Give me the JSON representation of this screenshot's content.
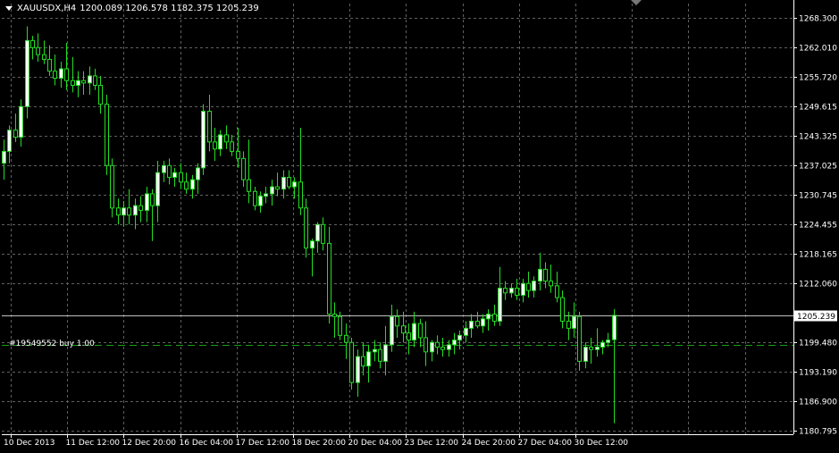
{
  "window": {
    "symbol_timeframe": "XAUUSDX,H4",
    "ohlc": "1200.089 1206.578 1182.375 1205.239"
  },
  "trade_line": {
    "label": "#19549552 buy 1.00",
    "price": 1199.0
  },
  "current_price": {
    "label": "1205.239",
    "value": 1205.239
  },
  "colors": {
    "background": "#000000",
    "grid": "#606060",
    "bull_fill": "#ffffff",
    "bear_fill": "#000000",
    "candle_outline": "#22dd22",
    "trade_line": "#1aa01a",
    "axis_text": "#ffffff"
  },
  "icons": {
    "menu": "triangle-down-icon",
    "scroll": "scroll-marker-icon"
  },
  "chart_data": {
    "type": "candlestick",
    "title": "XAUUSDX,H4",
    "grid": true,
    "y_ticks": [
      "1268.300",
      "1262.010",
      "1255.720",
      "1249.615",
      "1243.325",
      "1237.025",
      "1230.745",
      "1224.455",
      "1218.165",
      "1212.060",
      "1205.239",
      "1199.480",
      "1193.190",
      "1186.900",
      "1180.795"
    ],
    "y_range": [
      1180.795,
      1268.3
    ],
    "x_ticks": [
      "10 Dec 2013",
      "11 Dec 12:00",
      "12 Dec 20:00",
      "16 Dec 04:00",
      "17 Dec 12:00",
      "18 Dec 20:00",
      "20 Dec 04:00",
      "23 Dec 12:00",
      "24 Dec 20:00",
      "27 Dec 04:00",
      "30 Dec 12:00"
    ],
    "candles": [
      {
        "o": 1237.5,
        "h": 1242.5,
        "l": 1234.0,
        "c": 1240.0
      },
      {
        "o": 1240.0,
        "h": 1245.5,
        "l": 1237.5,
        "c": 1244.5
      },
      {
        "o": 1244.5,
        "h": 1248.0,
        "l": 1242.0,
        "c": 1243.0
      },
      {
        "o": 1243.0,
        "h": 1251.0,
        "l": 1241.0,
        "c": 1249.5
      },
      {
        "o": 1249.5,
        "h": 1266.5,
        "l": 1247.0,
        "c": 1263.5
      },
      {
        "o": 1263.5,
        "h": 1264.5,
        "l": 1259.5,
        "c": 1262.0
      },
      {
        "o": 1262.0,
        "h": 1265.0,
        "l": 1259.0,
        "c": 1260.5
      },
      {
        "o": 1260.5,
        "h": 1263.5,
        "l": 1258.5,
        "c": 1259.5
      },
      {
        "o": 1259.5,
        "h": 1262.5,
        "l": 1256.0,
        "c": 1257.0
      },
      {
        "o": 1257.0,
        "h": 1260.5,
        "l": 1254.0,
        "c": 1255.5
      },
      {
        "o": 1255.5,
        "h": 1259.0,
        "l": 1253.5,
        "c": 1257.5
      },
      {
        "o": 1257.5,
        "h": 1263.0,
        "l": 1253.0,
        "c": 1255.0
      },
      {
        "o": 1255.0,
        "h": 1260.0,
        "l": 1252.5,
        "c": 1254.0
      },
      {
        "o": 1254.0,
        "h": 1257.0,
        "l": 1251.5,
        "c": 1255.0
      },
      {
        "o": 1255.0,
        "h": 1257.0,
        "l": 1252.0,
        "c": 1254.5
      },
      {
        "o": 1254.5,
        "h": 1258.0,
        "l": 1252.0,
        "c": 1256.0
      },
      {
        "o": 1256.0,
        "h": 1257.5,
        "l": 1253.0,
        "c": 1254.0
      },
      {
        "o": 1254.0,
        "h": 1256.0,
        "l": 1248.0,
        "c": 1250.0
      },
      {
        "o": 1250.0,
        "h": 1252.0,
        "l": 1235.0,
        "c": 1237.0
      },
      {
        "o": 1237.0,
        "h": 1238.5,
        "l": 1226.0,
        "c": 1228.0
      },
      {
        "o": 1228.0,
        "h": 1230.0,
        "l": 1224.5,
        "c": 1226.5
      },
      {
        "o": 1226.5,
        "h": 1229.5,
        "l": 1224.0,
        "c": 1228.0
      },
      {
        "o": 1228.0,
        "h": 1232.0,
        "l": 1224.5,
        "c": 1226.5
      },
      {
        "o": 1226.5,
        "h": 1230.0,
        "l": 1223.5,
        "c": 1228.5
      },
      {
        "o": 1228.5,
        "h": 1230.5,
        "l": 1225.0,
        "c": 1227.5
      },
      {
        "o": 1227.5,
        "h": 1232.5,
        "l": 1225.0,
        "c": 1231.0
      },
      {
        "o": 1231.0,
        "h": 1232.0,
        "l": 1221.0,
        "c": 1228.5
      },
      {
        "o": 1228.5,
        "h": 1238.0,
        "l": 1225.0,
        "c": 1235.5
      },
      {
        "o": 1235.5,
        "h": 1238.0,
        "l": 1233.5,
        "c": 1237.0
      },
      {
        "o": 1237.0,
        "h": 1238.5,
        "l": 1233.0,
        "c": 1234.5
      },
      {
        "o": 1234.5,
        "h": 1236.5,
        "l": 1232.5,
        "c": 1235.5
      },
      {
        "o": 1235.5,
        "h": 1237.5,
        "l": 1232.0,
        "c": 1233.5
      },
      {
        "o": 1233.5,
        "h": 1235.5,
        "l": 1231.0,
        "c": 1232.0
      },
      {
        "o": 1232.0,
        "h": 1235.0,
        "l": 1230.0,
        "c": 1234.0
      },
      {
        "o": 1234.0,
        "h": 1237.5,
        "l": 1231.0,
        "c": 1236.5
      },
      {
        "o": 1236.5,
        "h": 1250.0,
        "l": 1235.0,
        "c": 1248.5
      },
      {
        "o": 1248.5,
        "h": 1252.0,
        "l": 1240.0,
        "c": 1242.0
      },
      {
        "o": 1242.0,
        "h": 1245.0,
        "l": 1238.0,
        "c": 1240.5
      },
      {
        "o": 1240.5,
        "h": 1244.5,
        "l": 1239.0,
        "c": 1243.5
      },
      {
        "o": 1243.5,
        "h": 1245.5,
        "l": 1240.5,
        "c": 1242.0
      },
      {
        "o": 1242.0,
        "h": 1243.5,
        "l": 1239.0,
        "c": 1240.0
      },
      {
        "o": 1240.0,
        "h": 1245.0,
        "l": 1236.5,
        "c": 1238.5
      },
      {
        "o": 1238.5,
        "h": 1240.0,
        "l": 1232.5,
        "c": 1234.0
      },
      {
        "o": 1234.0,
        "h": 1242.5,
        "l": 1229.0,
        "c": 1231.5
      },
      {
        "o": 1231.5,
        "h": 1232.5,
        "l": 1227.5,
        "c": 1228.5
      },
      {
        "o": 1228.5,
        "h": 1231.5,
        "l": 1227.0,
        "c": 1230.5
      },
      {
        "o": 1230.5,
        "h": 1232.5,
        "l": 1229.0,
        "c": 1231.0
      },
      {
        "o": 1231.0,
        "h": 1234.0,
        "l": 1228.5,
        "c": 1232.5
      },
      {
        "o": 1232.5,
        "h": 1235.5,
        "l": 1230.5,
        "c": 1232.0
      },
      {
        "o": 1232.0,
        "h": 1236.0,
        "l": 1230.0,
        "c": 1234.5
      },
      {
        "o": 1234.5,
        "h": 1236.0,
        "l": 1232.0,
        "c": 1232.5
      },
      {
        "o": 1232.5,
        "h": 1234.5,
        "l": 1230.0,
        "c": 1233.5
      },
      {
        "o": 1233.5,
        "h": 1245.0,
        "l": 1226.5,
        "c": 1228.0
      },
      {
        "o": 1228.0,
        "h": 1230.0,
        "l": 1217.5,
        "c": 1219.5
      },
      {
        "o": 1219.5,
        "h": 1221.5,
        "l": 1213.5,
        "c": 1221.0
      },
      {
        "o": 1221.0,
        "h": 1225.0,
        "l": 1218.5,
        "c": 1224.5
      },
      {
        "o": 1224.5,
        "h": 1226.0,
        "l": 1219.0,
        "c": 1220.5
      },
      {
        "o": 1220.5,
        "h": 1224.0,
        "l": 1203.5,
        "c": 1205.5
      },
      {
        "o": 1205.5,
        "h": 1208.0,
        "l": 1200.5,
        "c": 1205.0
      },
      {
        "o": 1205.0,
        "h": 1206.0,
        "l": 1200.0,
        "c": 1201.0
      },
      {
        "o": 1201.0,
        "h": 1203.5,
        "l": 1196.0,
        "c": 1199.5
      },
      {
        "o": 1199.5,
        "h": 1200.5,
        "l": 1189.5,
        "c": 1191.0
      },
      {
        "o": 1191.0,
        "h": 1198.0,
        "l": 1188.0,
        "c": 1196.5
      },
      {
        "o": 1196.5,
        "h": 1199.5,
        "l": 1192.5,
        "c": 1194.5
      },
      {
        "o": 1194.5,
        "h": 1199.0,
        "l": 1191.0,
        "c": 1197.5
      },
      {
        "o": 1197.5,
        "h": 1200.0,
        "l": 1195.5,
        "c": 1198.0
      },
      {
        "o": 1198.0,
        "h": 1199.5,
        "l": 1194.0,
        "c": 1195.5
      },
      {
        "o": 1195.5,
        "h": 1203.0,
        "l": 1192.5,
        "c": 1199.0
      },
      {
        "o": 1199.0,
        "h": 1207.5,
        "l": 1197.5,
        "c": 1205.0
      },
      {
        "o": 1205.0,
        "h": 1206.5,
        "l": 1200.5,
        "c": 1203.0
      },
      {
        "o": 1203.0,
        "h": 1206.0,
        "l": 1199.5,
        "c": 1201.5
      },
      {
        "o": 1201.5,
        "h": 1203.5,
        "l": 1197.0,
        "c": 1200.0
      },
      {
        "o": 1200.0,
        "h": 1206.0,
        "l": 1198.5,
        "c": 1203.5
      },
      {
        "o": 1203.5,
        "h": 1204.5,
        "l": 1198.5,
        "c": 1200.5
      },
      {
        "o": 1200.5,
        "h": 1204.0,
        "l": 1194.5,
        "c": 1197.5
      },
      {
        "o": 1197.5,
        "h": 1200.0,
        "l": 1195.5,
        "c": 1199.5
      },
      {
        "o": 1199.5,
        "h": 1201.0,
        "l": 1197.0,
        "c": 1198.5
      },
      {
        "o": 1198.5,
        "h": 1200.5,
        "l": 1196.5,
        "c": 1198.0
      },
      {
        "o": 1198.0,
        "h": 1200.0,
        "l": 1196.5,
        "c": 1199.0
      },
      {
        "o": 1199.0,
        "h": 1201.5,
        "l": 1197.0,
        "c": 1200.0
      },
      {
        "o": 1200.0,
        "h": 1202.0,
        "l": 1198.0,
        "c": 1201.0
      },
      {
        "o": 1201.0,
        "h": 1204.0,
        "l": 1199.5,
        "c": 1202.5
      },
      {
        "o": 1202.5,
        "h": 1205.5,
        "l": 1200.5,
        "c": 1204.0
      },
      {
        "o": 1204.0,
        "h": 1206.0,
        "l": 1202.5,
        "c": 1203.0
      },
      {
        "o": 1203.0,
        "h": 1205.5,
        "l": 1201.5,
        "c": 1204.5
      },
      {
        "o": 1204.5,
        "h": 1206.5,
        "l": 1202.0,
        "c": 1205.5
      },
      {
        "o": 1205.5,
        "h": 1207.5,
        "l": 1203.0,
        "c": 1204.0
      },
      {
        "o": 1204.0,
        "h": 1215.5,
        "l": 1203.0,
        "c": 1211.0
      },
      {
        "o": 1211.0,
        "h": 1212.5,
        "l": 1208.5,
        "c": 1210.0
      },
      {
        "o": 1210.0,
        "h": 1212.0,
        "l": 1209.0,
        "c": 1211.0
      },
      {
        "o": 1211.0,
        "h": 1213.0,
        "l": 1208.5,
        "c": 1209.5
      },
      {
        "o": 1209.5,
        "h": 1213.0,
        "l": 1208.0,
        "c": 1212.0
      },
      {
        "o": 1212.0,
        "h": 1214.5,
        "l": 1209.0,
        "c": 1210.5
      },
      {
        "o": 1210.5,
        "h": 1213.5,
        "l": 1209.0,
        "c": 1212.5
      },
      {
        "o": 1212.5,
        "h": 1218.5,
        "l": 1210.5,
        "c": 1215.0
      },
      {
        "o": 1215.0,
        "h": 1216.5,
        "l": 1211.0,
        "c": 1212.5
      },
      {
        "o": 1212.5,
        "h": 1216.0,
        "l": 1210.0,
        "c": 1211.5
      },
      {
        "o": 1211.5,
        "h": 1214.5,
        "l": 1208.0,
        "c": 1209.0
      },
      {
        "o": 1209.0,
        "h": 1210.5,
        "l": 1202.5,
        "c": 1204.0
      },
      {
        "o": 1204.0,
        "h": 1206.0,
        "l": 1200.0,
        "c": 1202.5
      },
      {
        "o": 1202.5,
        "h": 1208.0,
        "l": 1200.5,
        "c": 1205.0
      },
      {
        "o": 1205.0,
        "h": 1206.0,
        "l": 1193.5,
        "c": 1195.5
      },
      {
        "o": 1195.5,
        "h": 1199.5,
        "l": 1194.0,
        "c": 1198.5
      },
      {
        "o": 1198.5,
        "h": 1200.5,
        "l": 1195.0,
        "c": 1198.0
      },
      {
        "o": 1198.0,
        "h": 1202.5,
        "l": 1196.5,
        "c": 1198.5
      },
      {
        "o": 1198.5,
        "h": 1200.0,
        "l": 1197.0,
        "c": 1199.5
      },
      {
        "o": 1199.5,
        "h": 1201.5,
        "l": 1198.5,
        "c": 1200.0
      },
      {
        "o": 1200.089,
        "h": 1206.578,
        "l": 1182.375,
        "c": 1205.239
      }
    ]
  }
}
